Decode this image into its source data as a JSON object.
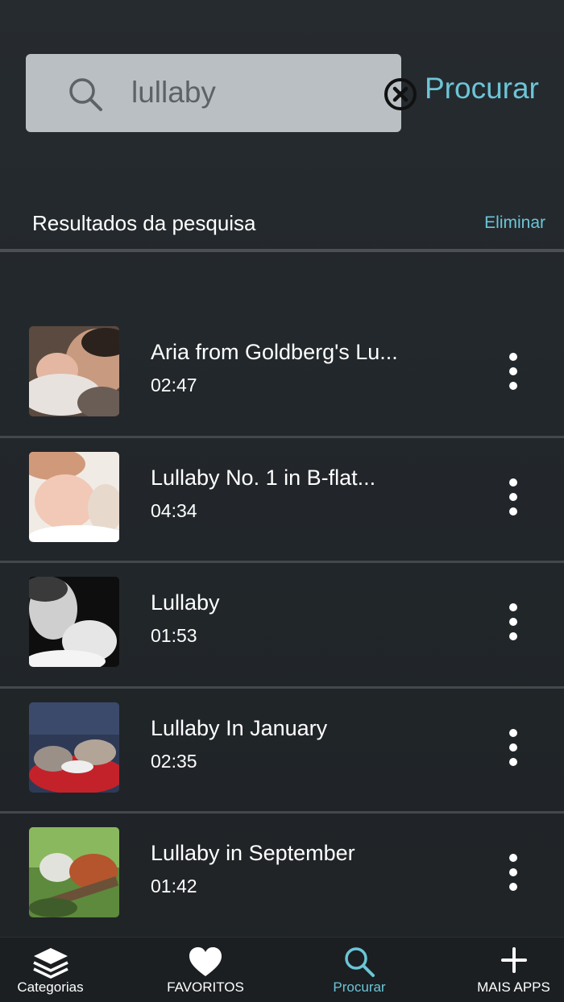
{
  "search": {
    "query": "lullaby",
    "button_label": "Procurar"
  },
  "results": {
    "title": "Resultados da pesquisa",
    "clear_label": "Eliminar",
    "items": [
      {
        "title": "Aria from Goldberg's Lu...",
        "duration": "02:47",
        "thumbnail": "father-and-newborn-photo"
      },
      {
        "title": "Lullaby No. 1 in B-flat...",
        "duration": "04:34",
        "thumbnail": "sleeping-child-photo"
      },
      {
        "title": "Lullaby",
        "duration": "01:53",
        "thumbnail": "father-and-baby-bw-photo"
      },
      {
        "title": "Lullaby In January",
        "duration": "02:35",
        "thumbnail": "sleeping-kittens-photo"
      },
      {
        "title": "Lullaby in September",
        "duration": "01:42",
        "thumbnail": "red-panda-photo"
      }
    ]
  },
  "tabs": [
    {
      "label": "Categorias",
      "icon": "layers-icon",
      "active": false
    },
    {
      "label": "FAVORITOS",
      "icon": "heart-icon",
      "active": false
    },
    {
      "label": "Procurar",
      "icon": "search-icon",
      "active": true
    },
    {
      "label": "MAIS APPS",
      "icon": "plus-icon",
      "active": false
    }
  ],
  "colors": {
    "accent": "#6cc5d7",
    "background": "#22262a",
    "search_field": "#b9bfc2"
  }
}
